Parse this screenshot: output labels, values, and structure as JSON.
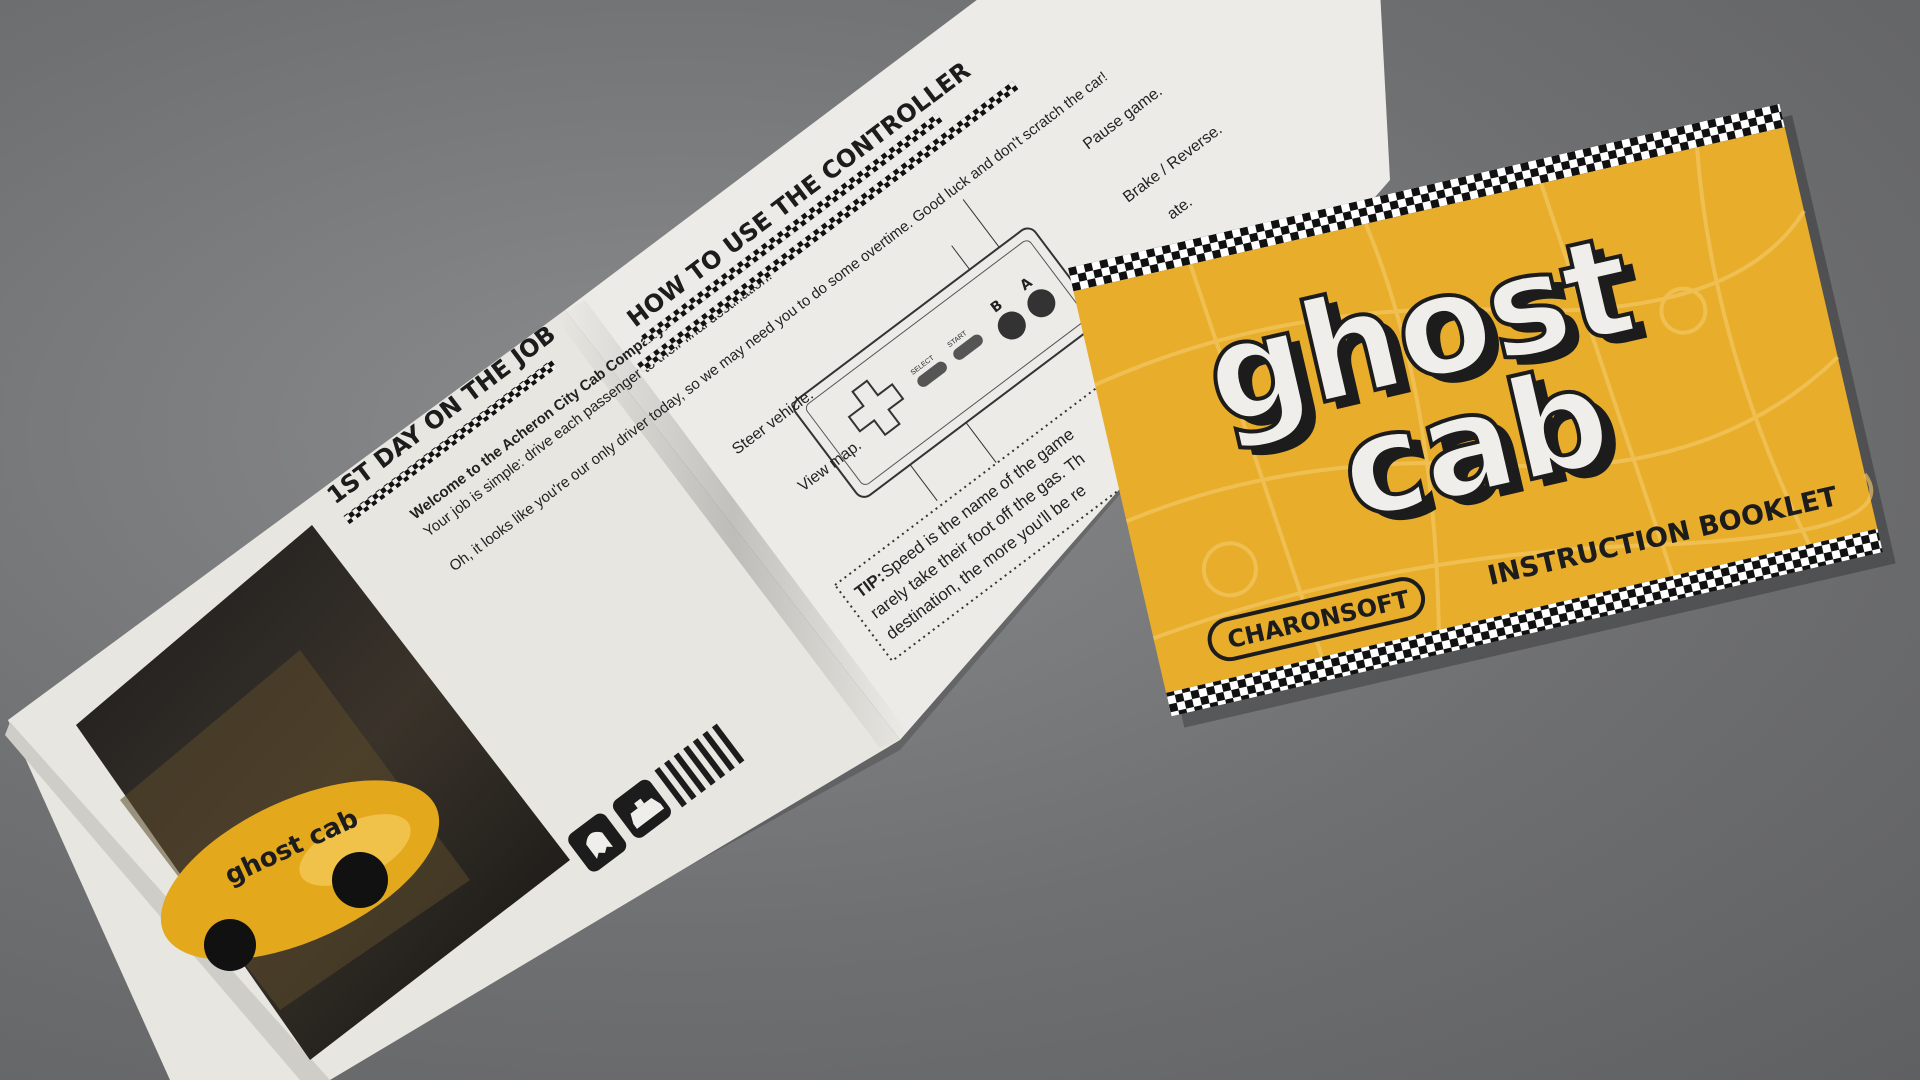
{
  "booklet_open": {
    "left_page": {
      "heading": "1ST DAY ON THE JOB",
      "intro_bold": "Welcome to the Acheron City Cab Company!",
      "intro_rest": "Your job is simple: drive each passenger to their final destination.",
      "para2": "Oh, it looks like you're our only driver today, so we may need you to do some overtime. Good luck and don't scratch the car!",
      "icons": [
        "ghost-icon",
        "taxi-icon"
      ],
      "photo_decal": "ghost cab"
    },
    "right_page": {
      "heading": "HOW TO USE THE CONTROLLER",
      "labels": {
        "pause": "Pause game.",
        "brake": "Brake / Reverse.",
        "accelerate": "ate.",
        "steer": "Steer vehicle.",
        "map": "View map."
      },
      "buttons": {
        "select": "SELECT",
        "start": "START",
        "b": "B",
        "a": "A"
      },
      "tip_label": "TIP:",
      "tip_lines": [
        "Speed is the name of the game",
        "rarely take their foot off the gas. Th",
        "destination, the more you'll be re"
      ]
    }
  },
  "cover": {
    "title_line1": "ghost",
    "title_line2": "cab",
    "publisher": "CHARONSOFT",
    "subtitle": "INSTRUCTION BOOKLET",
    "colors": {
      "yellow": "#e8ad2a",
      "black": "#1c1c1c",
      "cream": "#efeeea"
    }
  }
}
